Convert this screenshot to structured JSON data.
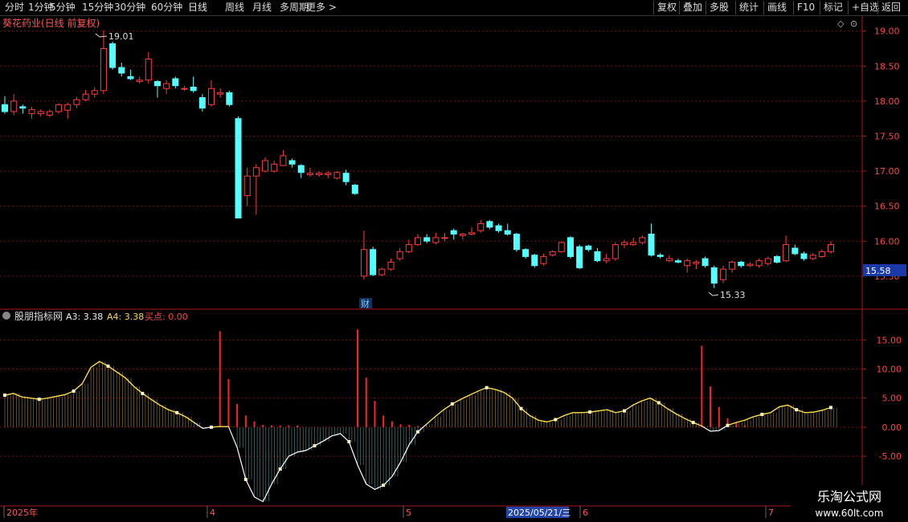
{
  "toolbar": {
    "periods": [
      "分时",
      "1分钟",
      "5分钟",
      "15分钟",
      "30分钟",
      "60分钟",
      "日线",
      "周线",
      "月线",
      "多周期",
      "更多 >"
    ],
    "active_period": "日线",
    "right_buttons": [
      "复权",
      "叠加",
      "多股",
      "统计",
      "画线",
      "F10",
      "标记",
      "+自选",
      "返回"
    ]
  },
  "main_panel": {
    "title": "葵花药业(日线 前复权)",
    "high_label": "19.01",
    "low_label": "15.33",
    "price_tag": "15.58",
    "fin_marker": "财"
  },
  "indicator_panel": {
    "name": "股朋指标网",
    "a3_label": "A3: 3.38",
    "a4_label": "A4: 3.38",
    "buy_label": "买点: 0.00"
  },
  "date_axis": {
    "labels": [
      {
        "text": "2025年",
        "x": 5
      },
      {
        "text": "4",
        "x": 258
      },
      {
        "text": "5",
        "x": 502
      },
      {
        "text": "6",
        "x": 722
      },
      {
        "text": "7",
        "x": 953
      }
    ],
    "cursor": "2025/05/21/三"
  },
  "watermark": {
    "line1": "乐淘公式网",
    "line2": "www.60lt.com"
  },
  "colors": {
    "up": "#ff3b3b",
    "down": "#54ffff",
    "axis": "#b01818",
    "line": "#ffffff",
    "yellow": "#ffdd33",
    "buy": "#ff2222"
  },
  "chart_data": [
    {
      "type": "candlestick",
      "y_ticks": [
        15.5,
        16.0,
        16.5,
        17.0,
        17.5,
        18.0,
        18.5,
        19.0
      ],
      "ylim": [
        15.2,
        19.1
      ],
      "candles": [
        [
          17.95,
          17.85,
          18.07,
          17.82
        ],
        [
          17.85,
          18.0,
          18.1,
          17.8
        ],
        [
          17.92,
          17.9,
          17.95,
          17.82
        ],
        [
          17.82,
          17.88,
          17.92,
          17.75
        ],
        [
          17.82,
          17.85,
          17.88,
          17.78
        ],
        [
          17.8,
          17.85,
          17.88,
          17.77
        ],
        [
          17.85,
          17.95,
          17.97,
          17.82
        ],
        [
          17.87,
          17.95,
          17.98,
          17.75
        ],
        [
          17.95,
          18.02,
          18.06,
          17.9
        ],
        [
          18.02,
          18.1,
          18.16,
          18.0
        ],
        [
          18.1,
          18.15,
          18.2,
          18.05
        ],
        [
          18.15,
          18.75,
          19.01,
          18.1
        ],
        [
          18.82,
          18.48,
          18.85,
          18.45
        ],
        [
          18.48,
          18.4,
          18.55,
          18.35
        ],
        [
          18.35,
          18.32,
          18.45,
          18.3
        ],
        [
          18.28,
          18.3,
          18.35,
          18.25
        ],
        [
          18.3,
          18.6,
          18.7,
          18.25
        ],
        [
          18.28,
          18.22,
          18.3,
          18.05
        ],
        [
          18.18,
          18.25,
          18.3,
          18.1
        ],
        [
          18.32,
          18.22,
          18.35,
          18.18
        ],
        [
          18.17,
          18.18,
          18.22,
          18.15
        ],
        [
          18.2,
          18.15,
          18.35,
          18.12
        ],
        [
          18.05,
          17.9,
          18.1,
          17.85
        ],
        [
          17.95,
          18.18,
          18.3,
          17.92
        ],
        [
          18.1,
          18.12,
          18.18,
          18.05
        ],
        [
          18.12,
          17.95,
          18.15,
          17.92
        ],
        [
          17.75,
          16.33,
          17.78,
          16.33
        ],
        [
          16.65,
          16.93,
          17.05,
          16.5
        ],
        [
          16.93,
          17.05,
          17.1,
          16.38
        ],
        [
          17.0,
          17.15,
          17.2,
          16.98
        ],
        [
          17.0,
          17.1,
          17.15,
          16.98
        ],
        [
          17.08,
          17.22,
          17.3,
          17.08
        ],
        [
          17.15,
          17.1,
          17.18,
          17.05
        ],
        [
          17.08,
          16.98,
          17.1,
          16.9
        ],
        [
          16.95,
          16.97,
          17.05,
          16.92
        ],
        [
          16.95,
          16.97,
          17.0,
          16.92
        ],
        [
          16.95,
          16.97,
          17.0,
          16.9
        ],
        [
          16.9,
          16.98,
          17.0,
          16.88
        ],
        [
          16.97,
          16.85,
          17.02,
          16.8
        ],
        [
          16.8,
          16.68,
          16.82,
          16.66
        ],
        [
          15.5,
          15.88,
          16.15,
          15.45
        ],
        [
          15.88,
          15.52,
          15.92,
          15.5
        ],
        [
          15.52,
          15.6,
          15.62,
          15.5
        ],
        [
          15.6,
          15.7,
          15.75,
          15.58
        ],
        [
          15.75,
          15.85,
          15.9,
          15.72
        ],
        [
          15.85,
          15.95,
          16.02,
          15.83
        ],
        [
          15.95,
          16.05,
          16.1,
          15.93
        ],
        [
          16.05,
          16.0,
          16.1,
          15.97
        ],
        [
          15.98,
          16.05,
          16.12,
          15.95
        ],
        [
          16.05,
          16.05,
          16.12,
          16.0
        ],
        [
          16.15,
          16.1,
          16.18,
          16.02
        ],
        [
          16.08,
          16.1,
          16.12,
          16.02
        ],
        [
          16.1,
          16.12,
          16.2,
          16.08
        ],
        [
          16.15,
          16.25,
          16.3,
          16.12
        ],
        [
          16.28,
          16.2,
          16.3,
          16.17
        ],
        [
          16.22,
          16.15,
          16.25,
          16.12
        ],
        [
          16.15,
          16.1,
          16.25,
          16.08
        ],
        [
          16.1,
          15.88,
          16.12,
          15.85
        ],
        [
          15.88,
          15.78,
          15.9,
          15.75
        ],
        [
          15.8,
          15.65,
          15.82,
          15.62
        ],
        [
          15.68,
          15.78,
          15.82,
          15.65
        ],
        [
          15.8,
          15.85,
          15.87,
          15.78
        ],
        [
          15.85,
          15.98,
          16.0,
          15.83
        ],
        [
          16.05,
          15.78,
          16.07,
          15.75
        ],
        [
          15.92,
          15.62,
          15.95,
          15.6
        ],
        [
          15.93,
          15.88,
          15.95,
          15.85
        ],
        [
          15.85,
          15.72,
          15.9,
          15.7
        ],
        [
          15.72,
          15.75,
          15.82,
          15.68
        ],
        [
          15.75,
          15.95,
          15.98,
          15.72
        ],
        [
          15.95,
          15.98,
          16.02,
          15.9
        ],
        [
          15.95,
          15.98,
          16.05,
          15.93
        ],
        [
          15.98,
          16.05,
          16.08,
          15.95
        ],
        [
          16.1,
          15.8,
          16.25,
          15.78
        ],
        [
          15.8,
          15.78,
          15.83,
          15.75
        ],
        [
          15.72,
          15.75,
          15.8,
          15.7
        ],
        [
          15.72,
          15.7,
          15.75,
          15.68
        ],
        [
          15.65,
          15.72,
          15.75,
          15.55
        ],
        [
          15.68,
          15.7,
          15.73,
          15.6
        ],
        [
          15.75,
          15.65,
          15.78,
          15.62
        ],
        [
          15.62,
          15.4,
          15.65,
          15.33
        ],
        [
          15.45,
          15.6,
          15.65,
          15.4
        ],
        [
          15.6,
          15.7,
          15.72,
          15.55
        ],
        [
          15.7,
          15.65,
          15.72,
          15.62
        ],
        [
          15.65,
          15.67,
          15.7,
          15.63
        ],
        [
          15.65,
          15.72,
          15.75,
          15.62
        ],
        [
          15.68,
          15.75,
          15.78,
          15.65
        ],
        [
          15.78,
          15.7,
          15.8,
          15.68
        ],
        [
          15.72,
          15.95,
          16.08,
          15.7
        ],
        [
          15.9,
          15.82,
          15.95,
          15.8
        ],
        [
          15.82,
          15.75,
          15.85,
          15.72
        ],
        [
          15.75,
          15.8,
          15.83,
          15.73
        ],
        [
          15.78,
          15.85,
          15.88,
          15.76
        ],
        [
          15.85,
          15.95,
          16.0,
          15.82
        ]
      ]
    },
    {
      "type": "line",
      "y_ticks": [
        -5,
        0,
        5,
        10,
        15
      ],
      "ylim": [
        -13,
        18.5
      ],
      "series": [
        {
          "name": "A3",
          "values": [
            5.5,
            5.8,
            5.2,
            5.0,
            4.8,
            5.0,
            5.3,
            5.6,
            6.2,
            7.5,
            10.3,
            11.3,
            10.5,
            9.5,
            8.5,
            7.0,
            5.8,
            4.8,
            3.8,
            3.0,
            2.5,
            1.8,
            0.8,
            -0.2,
            0.0,
            0.1,
            0.1,
            -3.5,
            -9.0,
            -12.0,
            -12.8,
            -9.8,
            -7.2,
            -5.0,
            -4.3,
            -4.0,
            -3.2,
            -2.4,
            -1.5,
            -1.1,
            -2.5,
            -6.5,
            -9.8,
            -10.7,
            -10.0,
            -8.5,
            -6.0,
            -3.0,
            -0.8,
            0.5,
            1.8,
            3.0,
            4.0,
            4.8,
            5.5,
            6.2,
            6.8,
            6.5,
            6.0,
            5.0,
            3.2,
            2.0,
            1.2,
            0.9,
            1.3,
            2.0,
            2.5,
            2.5,
            2.6,
            2.8,
            3.0,
            2.5,
            2.8,
            3.8,
            4.5,
            5.0,
            4.2,
            3.2,
            2.3,
            1.5,
            0.8,
            0.2,
            -0.7,
            -0.6,
            0.3,
            0.8,
            1.2,
            1.8,
            2.2,
            2.5,
            3.5,
            3.8,
            3.0,
            2.5,
            2.6,
            2.9,
            3.38
          ]
        },
        {
          "name": "买点",
          "values": [
            0,
            0,
            0,
            0,
            0,
            0,
            0,
            0,
            0,
            0,
            0,
            0,
            0,
            0,
            0,
            0,
            0,
            0,
            0,
            0,
            0,
            0,
            0,
            0,
            0,
            16.5,
            8.3,
            4.0,
            2.0,
            1.0,
            0.4,
            0.3,
            0.3,
            0.3,
            0.3,
            0,
            0,
            0,
            0,
            0,
            0,
            16.8,
            8.5,
            4.5,
            2.0,
            1.0,
            0.5,
            0.4,
            0.2,
            0,
            0,
            0,
            0,
            0,
            0,
            0,
            0,
            0,
            0,
            0,
            0,
            0,
            0,
            0,
            0,
            0,
            0,
            0,
            0,
            0,
            0,
            0,
            0,
            0,
            0,
            0,
            0,
            0,
            0,
            0,
            0,
            14.0,
            7.0,
            3.5,
            1.5,
            0.8,
            0.3,
            0,
            0,
            0,
            0,
            0,
            0,
            0,
            0,
            0,
            0
          ]
        }
      ]
    }
  ]
}
